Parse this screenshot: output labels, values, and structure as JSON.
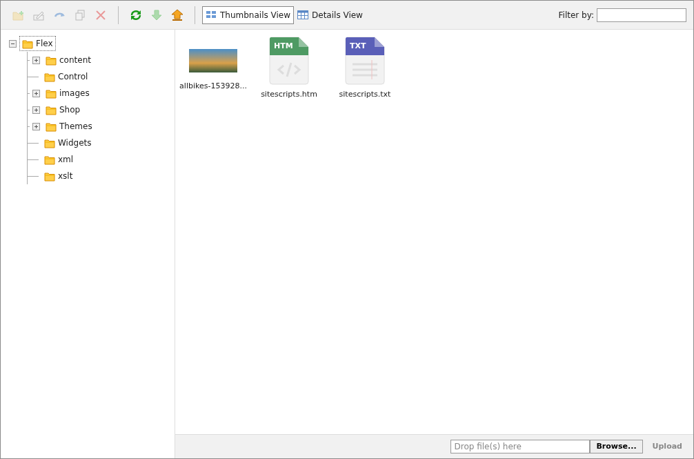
{
  "toolbar": {
    "tools": [
      {
        "kind": "new-folder",
        "disabled": true
      },
      {
        "kind": "rename",
        "disabled": true
      },
      {
        "kind": "move",
        "disabled": true
      },
      {
        "kind": "copy",
        "disabled": true
      },
      {
        "kind": "delete",
        "disabled": true
      },
      {
        "kind": "refresh",
        "disabled": false
      },
      {
        "kind": "download",
        "disabled": true
      },
      {
        "kind": "upload",
        "disabled": false
      }
    ],
    "views": [
      {
        "label": "Thumbnails View",
        "kind": "thumbnails",
        "selected": true
      },
      {
        "label": "Details View",
        "kind": "details",
        "selected": false
      }
    ],
    "filter": {
      "label": "Filter by:"
    }
  },
  "tree": [
    {
      "label": "Flex",
      "expanded": true,
      "selected": true,
      "children": [
        {
          "label": "content",
          "expandable": true,
          "selected": false
        },
        {
          "label": "Control",
          "expandable": false,
          "selected": false
        },
        {
          "label": "images",
          "expandable": true,
          "selected": false
        },
        {
          "label": "Shop",
          "expandable": true,
          "selected": false
        },
        {
          "label": "Themes",
          "expandable": true,
          "selected": false
        },
        {
          "label": "Widgets",
          "expandable": false,
          "selected": false
        },
        {
          "label": "xml",
          "expandable": false,
          "selected": false
        },
        {
          "label": "xslt",
          "expandable": false,
          "selected": false
        }
      ]
    }
  ],
  "files": [
    {
      "name": "allbikes-153928...",
      "kind": "image"
    },
    {
      "name": "sitescripts.htm",
      "kind": "htm",
      "badge": "HTM"
    },
    {
      "name": "sitescripts.txt",
      "kind": "txt",
      "badge": "TXT"
    }
  ],
  "upload": {
    "placeholder": "Drop file(s) here",
    "browse": "Browse...",
    "upload": "Upload"
  }
}
